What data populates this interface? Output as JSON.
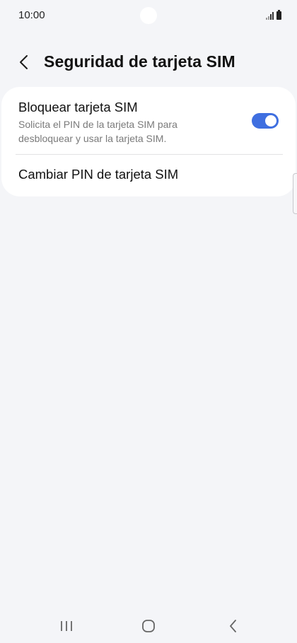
{
  "status_bar": {
    "time": "10:00",
    "icons": [
      "signal-icon",
      "battery-icon"
    ]
  },
  "header": {
    "title": "Seguridad de tarjeta SIM",
    "back_icon": "back-arrow-icon"
  },
  "settings": {
    "lock_sim": {
      "title": "Bloquear tarjeta SIM",
      "subtitle": "Solicita el PIN de la tarjeta SIM para desbloquear y usar la tarjeta SIM.",
      "enabled": true
    },
    "change_pin": {
      "title": "Cambiar PIN de tarjeta SIM"
    }
  },
  "nav_bar": {
    "icons": [
      "recent-apps-icon",
      "home-icon",
      "back-icon"
    ]
  },
  "colors": {
    "background": "#f4f5f8",
    "card": "#ffffff",
    "toggle_on": "#3f6fe0",
    "subtitle": "#7a7a7a"
  }
}
